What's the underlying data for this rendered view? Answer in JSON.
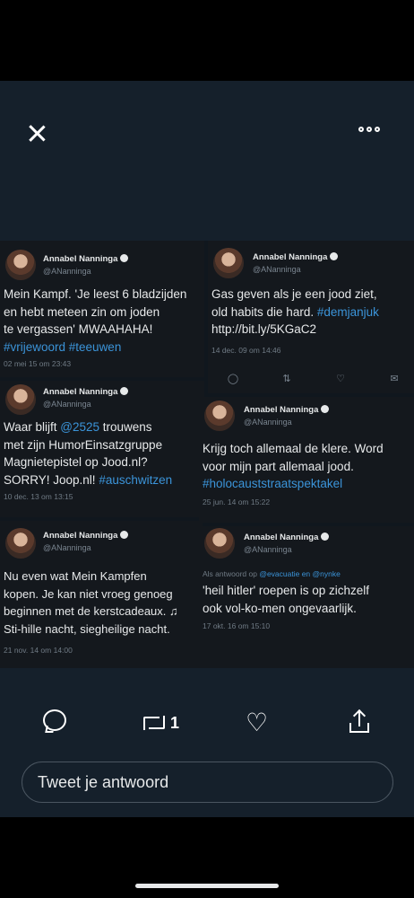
{
  "tweets": [
    {
      "name": "Annabel Nanninga",
      "handle": "@ANanninga",
      "lines": [
        "Mein Kampf. 'Je leest 6 bladzijden",
        "en hebt meteen zin om joden",
        "te vergassen' MWAAHAHA!"
      ],
      "links": "#vrijewoord #teeuwen",
      "date": "02 mei 15 om 23:43"
    },
    {
      "name": "Annabel Nanninga",
      "handle": "@ANanninga",
      "lines": [
        "Gas geven als je een jood ziet,"
      ],
      "line2_text": "old habits die hard. ",
      "line2_link": "#demjanjuk",
      "line3": "http://bit.ly/5KGaC2",
      "date": "14 dec. 09 om 14:46"
    },
    {
      "name": "Annabel Nanninga",
      "handle": "@ANanninga",
      "line1_text": "Waar blijft ",
      "line1_link": "@2525",
      "line1_rest": " trouwens",
      "lines": [
        "met zijn HumorEinsatzgruppe",
        "Magnietepistel op Jood.nl?"
      ],
      "line4_text": "SORRY! Joop.nl! ",
      "line4_link": "#auschwitzen",
      "date": "10 dec. 13 om 13:15"
    },
    {
      "name": "Annabel Nanninga",
      "handle": "@ANanninga",
      "lines": [
        "Krijg toch allemaal de klere. Word",
        "voor mijn part allemaal jood."
      ],
      "links": "#holocauststraatspektakel",
      "date": "25 jun. 14 om 15:22"
    },
    {
      "name": "Annabel Nanninga",
      "handle": "@ANanninga",
      "lines": [
        "Nu even wat Mein Kampfen",
        "kopen. Je kan niet vroeg genoeg",
        "beginnen met de kerstcadeaux. ♫",
        "Sti-hille nacht, siegheilige nacht."
      ],
      "date": "21 nov. 14 om 14:00"
    },
    {
      "name": "Annabel Nanninga",
      "handle": "@ANanninga",
      "reply_prefix": "Als antwoord op ",
      "reply_to": "@evacuatie en @nynke",
      "lines": [
        "'heil hitler' roepen is op zichzelf",
        "ook vol-ko-men ongevaarlijk."
      ],
      "date": "17 okt. 16 om 15:10"
    }
  ],
  "actions": {
    "retweet_count": "1",
    "like_glyph": "♡"
  },
  "reply_placeholder": "Tweet je antwoord",
  "colors": {
    "background": "#15202b",
    "link": "#3b94d9",
    "text": "#e7e9ea"
  }
}
